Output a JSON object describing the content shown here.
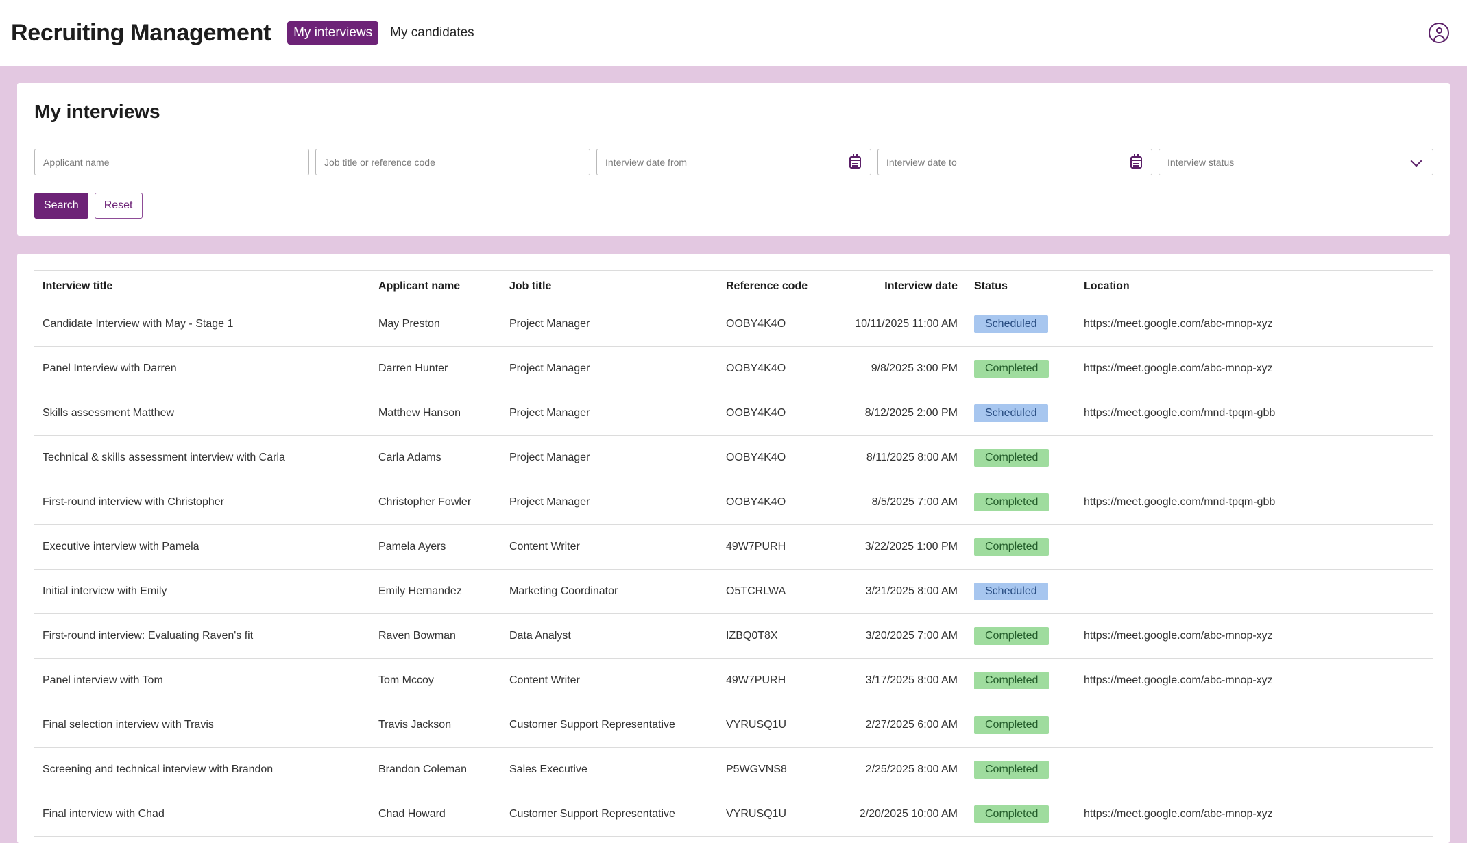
{
  "app": {
    "title": "Recruiting Management",
    "nav": [
      {
        "label": "My interviews",
        "active": true
      },
      {
        "label": "My candidates",
        "active": false
      }
    ],
    "user_icon": "user-circle-icon"
  },
  "search": {
    "title": "My interviews",
    "fields": {
      "applicant_name": {
        "placeholder": "Applicant name",
        "value": ""
      },
      "job_title": {
        "placeholder": "Job title or reference code",
        "value": ""
      },
      "date_from": {
        "placeholder": "Interview date from",
        "value": "",
        "icon": "calendar-icon"
      },
      "date_to": {
        "placeholder": "Interview date to",
        "value": "",
        "icon": "calendar-icon"
      },
      "status": {
        "placeholder": "Interview status",
        "value": "",
        "icon": "chevron-down-icon"
      }
    },
    "search_label": "Search",
    "reset_label": "Reset"
  },
  "table": {
    "columns": [
      "Interview title",
      "Applicant name",
      "Job title",
      "Reference code",
      "Interview date",
      "Status",
      "Location"
    ],
    "rows": [
      {
        "title": "Candidate Interview with May - Stage 1",
        "applicant": "May Preston",
        "job": "Project Manager",
        "ref": "OOBY4K4O",
        "date": "10/11/2025 11:00 AM",
        "status": "Scheduled",
        "location": "https://meet.google.com/abc-mnop-xyz"
      },
      {
        "title": "Panel Interview with Darren",
        "applicant": "Darren Hunter",
        "job": "Project Manager",
        "ref": "OOBY4K4O",
        "date": "9/8/2025 3:00 PM",
        "status": "Completed",
        "location": "https://meet.google.com/abc-mnop-xyz"
      },
      {
        "title": "Skills assessment Matthew",
        "applicant": "Matthew Hanson",
        "job": "Project Manager",
        "ref": "OOBY4K4O",
        "date": "8/12/2025 2:00 PM",
        "status": "Scheduled",
        "location": "https://meet.google.com/mnd-tpqm-gbb"
      },
      {
        "title": "Technical & skills assessment interview with Carla",
        "applicant": "Carla Adams",
        "job": "Project Manager",
        "ref": "OOBY4K4O",
        "date": "8/11/2025 8:00 AM",
        "status": "Completed",
        "location": ""
      },
      {
        "title": "First-round interview with Christopher",
        "applicant": "Christopher Fowler",
        "job": "Project Manager",
        "ref": "OOBY4K4O",
        "date": "8/5/2025 7:00 AM",
        "status": "Completed",
        "location": "https://meet.google.com/mnd-tpqm-gbb"
      },
      {
        "title": "Executive interview with Pamela",
        "applicant": "Pamela Ayers",
        "job": "Content Writer",
        "ref": "49W7PURH",
        "date": "3/22/2025 1:00 PM",
        "status": "Completed",
        "location": ""
      },
      {
        "title": "Initial interview with Emily",
        "applicant": "Emily Hernandez",
        "job": "Marketing Coordinator",
        "ref": "O5TCRLWA",
        "date": "3/21/2025 8:00 AM",
        "status": "Scheduled",
        "location": ""
      },
      {
        "title": "First-round interview: Evaluating Raven's fit",
        "applicant": "Raven Bowman",
        "job": "Data Analyst",
        "ref": "IZBQ0T8X",
        "date": "3/20/2025 7:00 AM",
        "status": "Completed",
        "location": "https://meet.google.com/abc-mnop-xyz"
      },
      {
        "title": "Panel interview with Tom",
        "applicant": "Tom Mccoy",
        "job": "Content Writer",
        "ref": "49W7PURH",
        "date": "3/17/2025 8:00 AM",
        "status": "Completed",
        "location": "https://meet.google.com/abc-mnop-xyz"
      },
      {
        "title": "Final selection interview with Travis",
        "applicant": "Travis Jackson",
        "job": "Customer Support Representative",
        "ref": "VYRUSQ1U",
        "date": "2/27/2025 6:00 AM",
        "status": "Completed",
        "location": ""
      },
      {
        "title": "Screening and technical interview with Brandon",
        "applicant": "Brandon Coleman",
        "job": "Sales Executive",
        "ref": "P5WGVNS8",
        "date": "2/25/2025 8:00 AM",
        "status": "Completed",
        "location": ""
      },
      {
        "title": "Final interview with Chad",
        "applicant": "Chad Howard",
        "job": "Customer Support Representative",
        "ref": "VYRUSQ1U",
        "date": "2/20/2025 10:00 AM",
        "status": "Completed",
        "location": "https://meet.google.com/abc-mnop-xyz"
      }
    ]
  },
  "colors": {
    "brand": "#6d2377",
    "background": "#e3c8e1",
    "scheduled_badge": "#a7c6ef",
    "completed_badge": "#9fdc9e"
  }
}
